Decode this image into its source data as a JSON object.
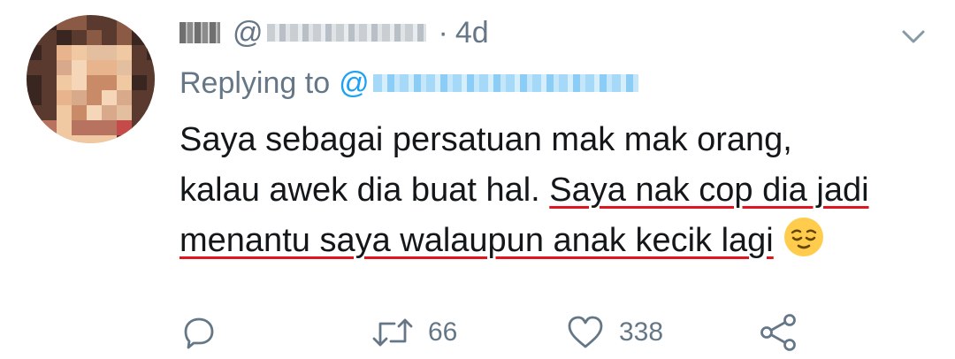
{
  "tweet": {
    "header": {
      "at_sign": "@",
      "time": "4d"
    },
    "replying": {
      "prefix": "Replying to",
      "at_sign": "@"
    },
    "body": {
      "line1": "Saya sebagai persatuan mak mak orang,",
      "line2_plain": "kalau awek dia buat hal. ",
      "line2_marked": "Saya nak cop dia jadi",
      "line3_marked": "menantu saya walaupun anak kecik lagi",
      "emoji": "relieved-face-emoji"
    },
    "actions": {
      "reply_icon": "reply-icon",
      "retweet_icon": "retweet-icon",
      "retweet_count": "66",
      "like_icon": "heart-icon",
      "like_count": "338",
      "share_icon": "share-icon"
    },
    "colors": {
      "text": "#14171a",
      "secondary": "#657786",
      "link": "#1da1f2",
      "underline_mark": "#e0151f"
    }
  }
}
